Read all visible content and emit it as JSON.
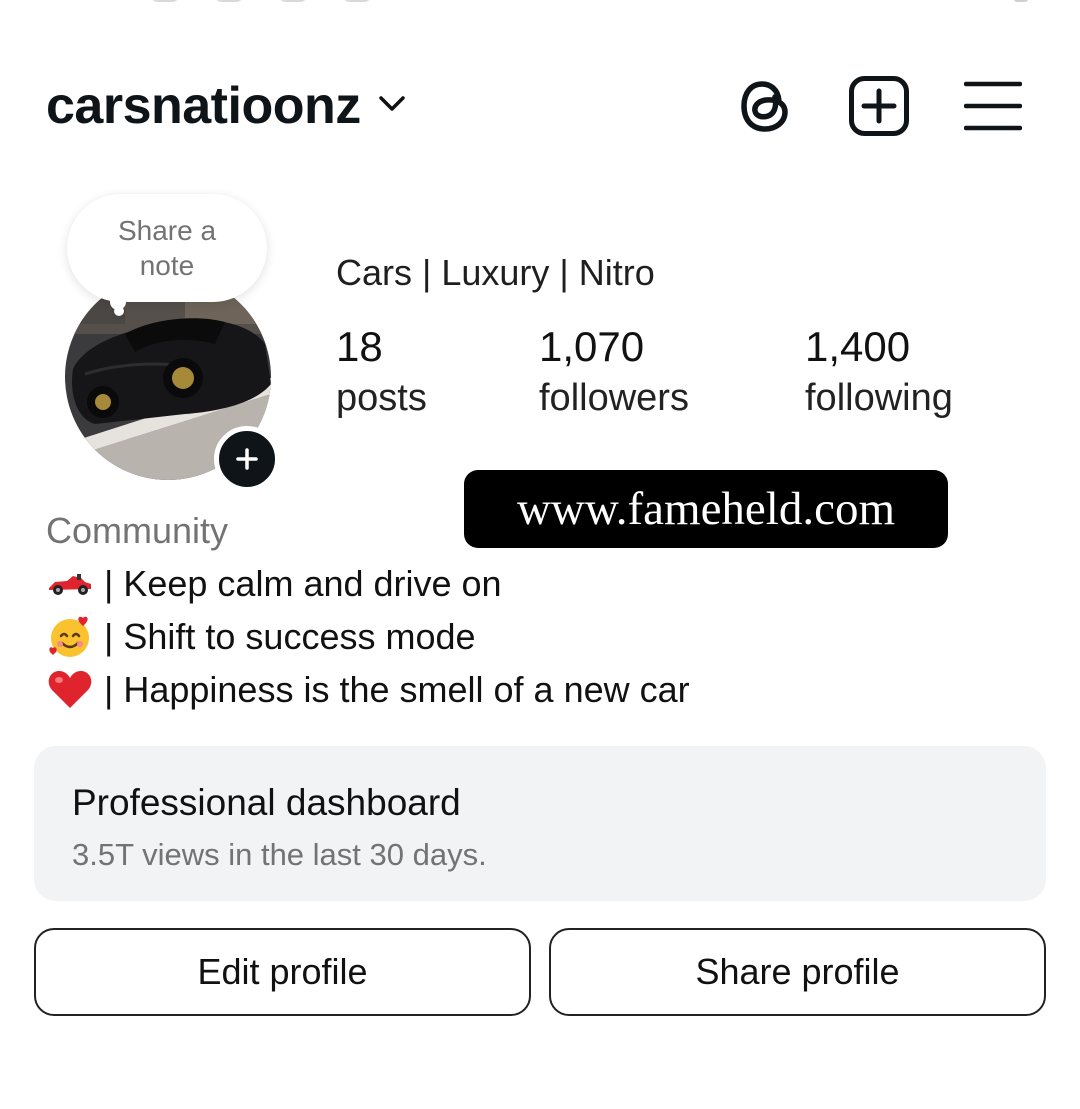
{
  "header": {
    "username": "carsnatioonz"
  },
  "profile": {
    "note_prompt_line1": "Share a",
    "note_prompt_line2": "note",
    "category": "Cars | Luxury | Nitro",
    "stats": [
      {
        "value": "18",
        "label": "posts"
      },
      {
        "value": "1,070",
        "label": "followers"
      },
      {
        "value": "1,400",
        "label": "following"
      }
    ]
  },
  "watermark": "www.fameheld.com",
  "bio": {
    "category": "Community",
    "lines": [
      {
        "emoji": "race-car-emoji",
        "text": "| Keep calm and drive on"
      },
      {
        "emoji": "smiling-hearts-emoji",
        "text": "| Shift to success mode"
      },
      {
        "emoji": "red-heart-emoji",
        "text": "| Happiness is the smell of a new car"
      }
    ]
  },
  "dashboard": {
    "title": "Professional dashboard",
    "subtitle": "3.5T views in the last 30 days."
  },
  "actions": {
    "edit": "Edit profile",
    "share": "Share profile"
  },
  "colors": {
    "text": "#0f1419",
    "muted": "#737373",
    "card_bg": "#f2f3f5",
    "heart": "#e0242e"
  }
}
